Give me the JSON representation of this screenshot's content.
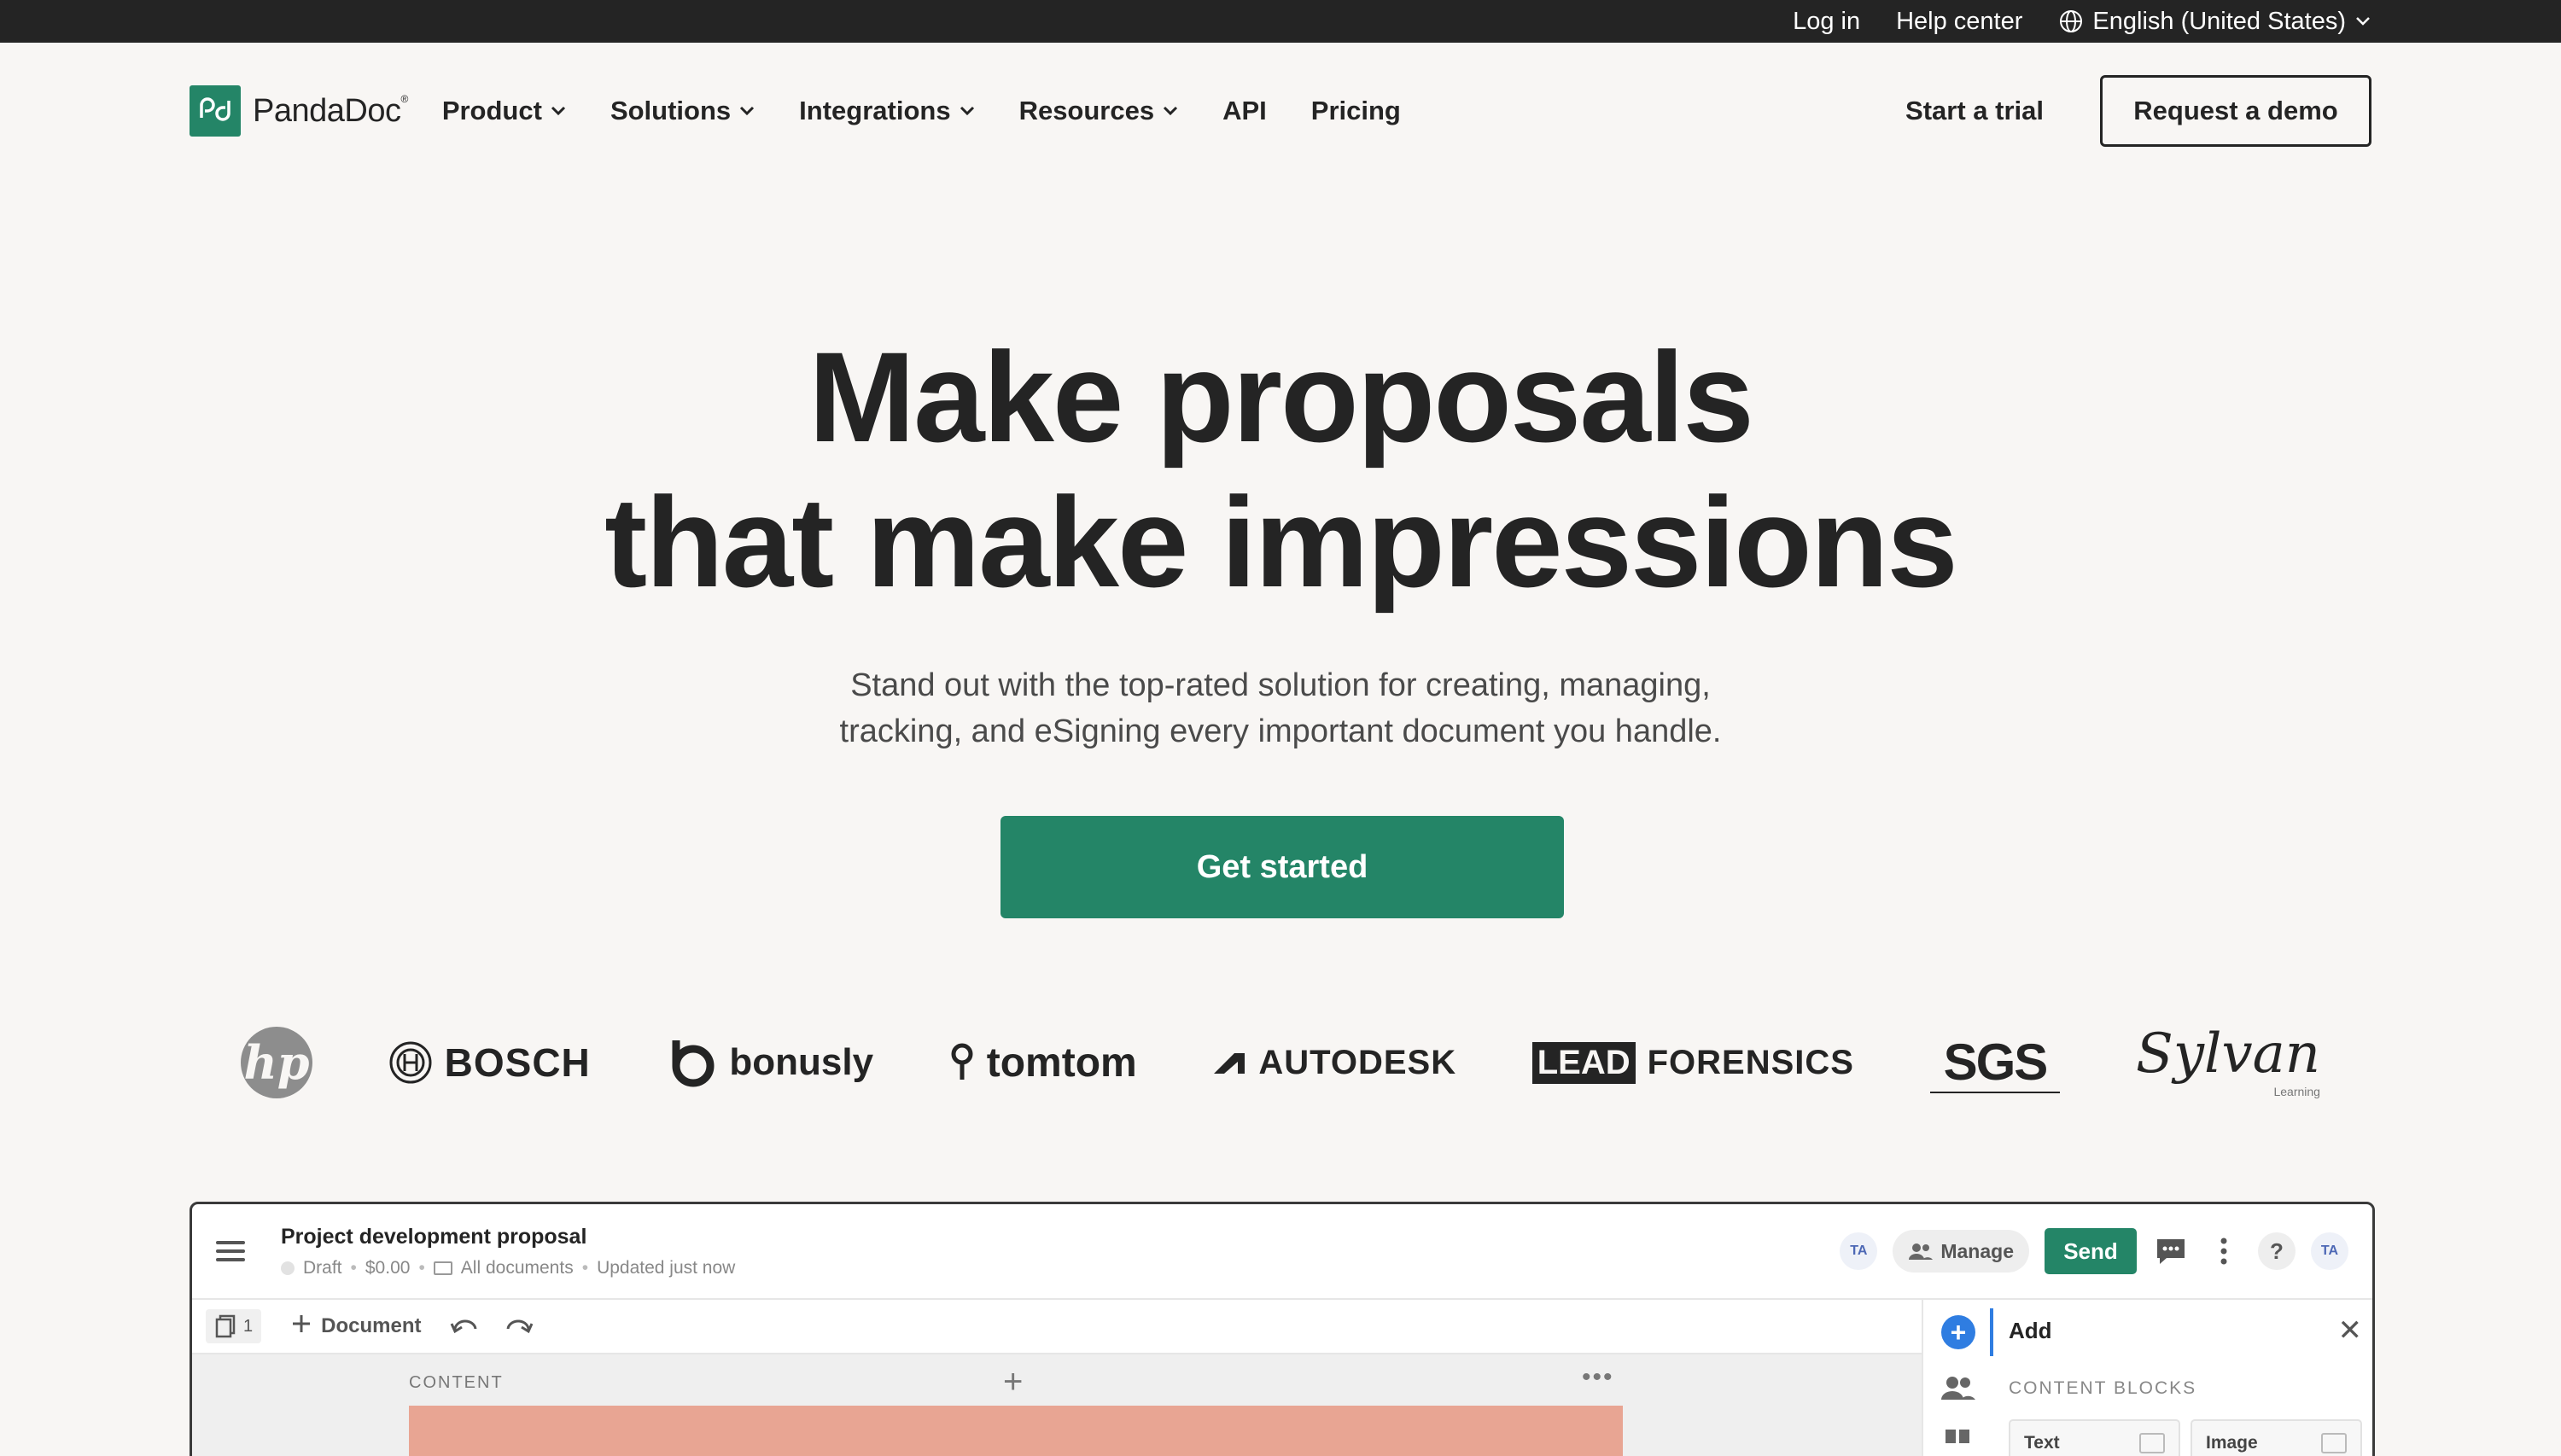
{
  "topbar": {
    "login": "Log in",
    "help": "Help center",
    "language": "English (United States)"
  },
  "nav": {
    "brand": "PandaDoc",
    "brand_mark": "®",
    "items": [
      {
        "label": "Product",
        "has_dropdown": true
      },
      {
        "label": "Solutions",
        "has_dropdown": true
      },
      {
        "label": "Integrations",
        "has_dropdown": true
      },
      {
        "label": "Resources",
        "has_dropdown": true
      },
      {
        "label": "API",
        "has_dropdown": false
      },
      {
        "label": "Pricing",
        "has_dropdown": false
      }
    ],
    "trial": "Start a trial",
    "demo": "Request a demo"
  },
  "hero": {
    "title_line1": "Make proposals",
    "title_line2": "that make impressions",
    "subtitle_line1": "Stand out with the top-rated solution for creating, managing,",
    "subtitle_line2": "tracking, and eSigning every important document you handle.",
    "cta": "Get started"
  },
  "logos": {
    "hp": "hp",
    "bosch": "BOSCH",
    "bonusly": "bonusly",
    "tomtom": "tomtom",
    "autodesk": "AUTODESK",
    "lead": "LEAD",
    "forensics": "FORENSICS",
    "sgs": "SGS",
    "sylvan": "Sylvan",
    "sylvan_sub": "Learning"
  },
  "preview": {
    "title": "Project development proposal",
    "status": "Draft",
    "amount": "$0.00",
    "folder": "All documents",
    "updated": "Updated just now",
    "avatar": "TA",
    "manage": "Manage",
    "send": "Send",
    "help": "?",
    "page_count": "1",
    "document": "Document",
    "content_label": "CONTENT",
    "panel_title": "Add",
    "content_blocks": "CONTENT BLOCKS",
    "tile_text": "Text",
    "tile_image": "Image"
  },
  "colors": {
    "brand_green": "#248567",
    "topbar_bg": "#242424",
    "page_bg": "#f8f6f4",
    "accent_blue": "#2f7de1",
    "block_salmon": "#e8a593"
  }
}
